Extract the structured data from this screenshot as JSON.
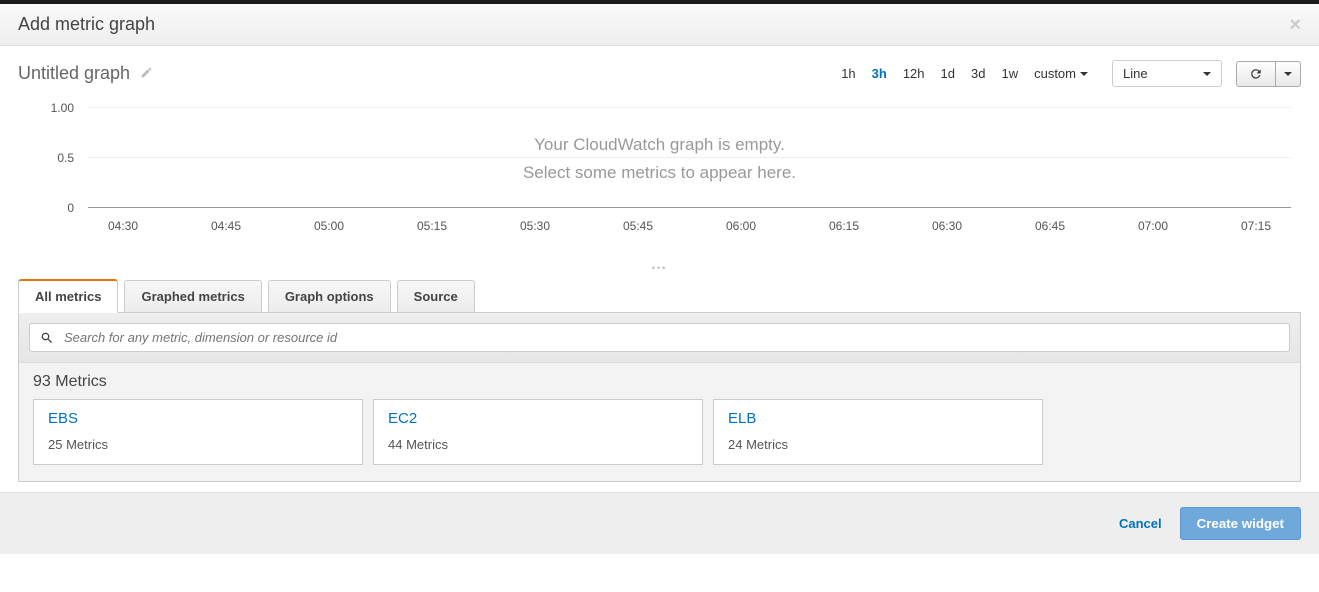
{
  "header": {
    "title": "Add metric graph"
  },
  "graph": {
    "name": "Untitled graph",
    "empty_line1": "Your CloudWatch graph is empty.",
    "empty_line2": "Select some metrics to appear here."
  },
  "time_ranges": {
    "opts": [
      "1h",
      "3h",
      "12h",
      "1d",
      "3d",
      "1w"
    ],
    "custom": "custom",
    "active": "3h"
  },
  "graph_type_select": "Line",
  "chart_data": {
    "type": "line",
    "series": [],
    "y_ticks": [
      "1.00",
      "0.5",
      "0"
    ],
    "x_ticks": [
      "04:30",
      "04:45",
      "05:00",
      "05:15",
      "05:30",
      "05:45",
      "06:00",
      "06:15",
      "06:30",
      "06:45",
      "07:00",
      "07:15"
    ],
    "ylim": [
      0,
      1.0
    ]
  },
  "tabs": {
    "items": [
      "All metrics",
      "Graphed metrics",
      "Graph options",
      "Source"
    ],
    "active": "All metrics"
  },
  "search": {
    "placeholder": "Search for any metric, dimension or resource id"
  },
  "metrics": {
    "heading": "93 Metrics",
    "cards": [
      {
        "title": "EBS",
        "sub": "25 Metrics"
      },
      {
        "title": "EC2",
        "sub": "44 Metrics"
      },
      {
        "title": "ELB",
        "sub": "24 Metrics"
      }
    ]
  },
  "footer": {
    "cancel": "Cancel",
    "create": "Create widget"
  }
}
